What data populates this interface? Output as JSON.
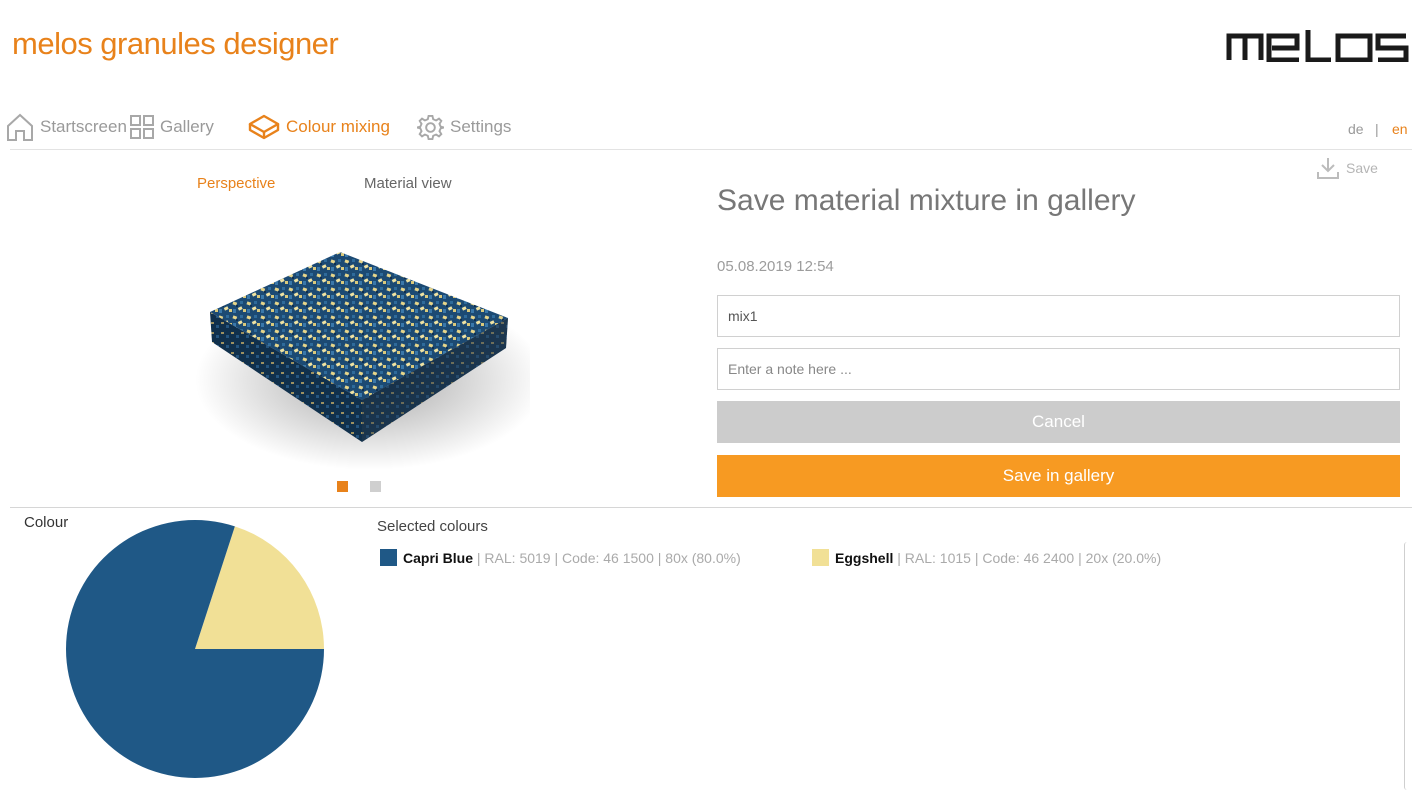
{
  "header": {
    "app_title": "melos granules designer",
    "logo_text": "melos"
  },
  "nav": {
    "items": [
      {
        "label": "Startscreen",
        "icon": "home-icon"
      },
      {
        "label": "Gallery",
        "icon": "grid-icon"
      },
      {
        "label": "Colour mixing",
        "icon": "box-icon",
        "active": true
      },
      {
        "label": "Settings",
        "icon": "gear-icon"
      }
    ],
    "languages": [
      {
        "label": "de"
      },
      {
        "label": "en",
        "active": true
      }
    ],
    "lang_separator": "|"
  },
  "toolbar": {
    "save_label": "Save"
  },
  "preview": {
    "tabs": [
      {
        "label": "Perspective",
        "active": true
      },
      {
        "label": "Material view"
      }
    ],
    "active_slide": 1,
    "slide_count": 2
  },
  "form": {
    "title": "Save material mixture in gallery",
    "date": "05.08.2019 12:54",
    "name_value": "mix1",
    "note_placeholder": "Enter a note here ...",
    "cancel_label": "Cancel",
    "save_label": "Save in gallery"
  },
  "colours": {
    "chart_label": "Colour",
    "selected_label": "Selected colours",
    "entries": [
      {
        "name": "Capri Blue",
        "details": " | RAL: 5019 | Code: 46 1500 | 80x (80.0%)",
        "color": "#1f5886"
      },
      {
        "name": "Eggshell",
        "details": " | RAL: 1015 | Code: 46 2400 | 20x (20.0%)",
        "color": "#f1e096"
      }
    ]
  },
  "chart_data": {
    "type": "pie",
    "title": "Colour",
    "categories": [
      "Capri Blue",
      "Eggshell"
    ],
    "values": [
      80,
      20
    ],
    "colors": [
      "#1f5886",
      "#f1e096"
    ]
  },
  "colors": {
    "accent": "#e8821b",
    "button_primary": "#f79a22",
    "button_secondary": "#cccccc"
  }
}
